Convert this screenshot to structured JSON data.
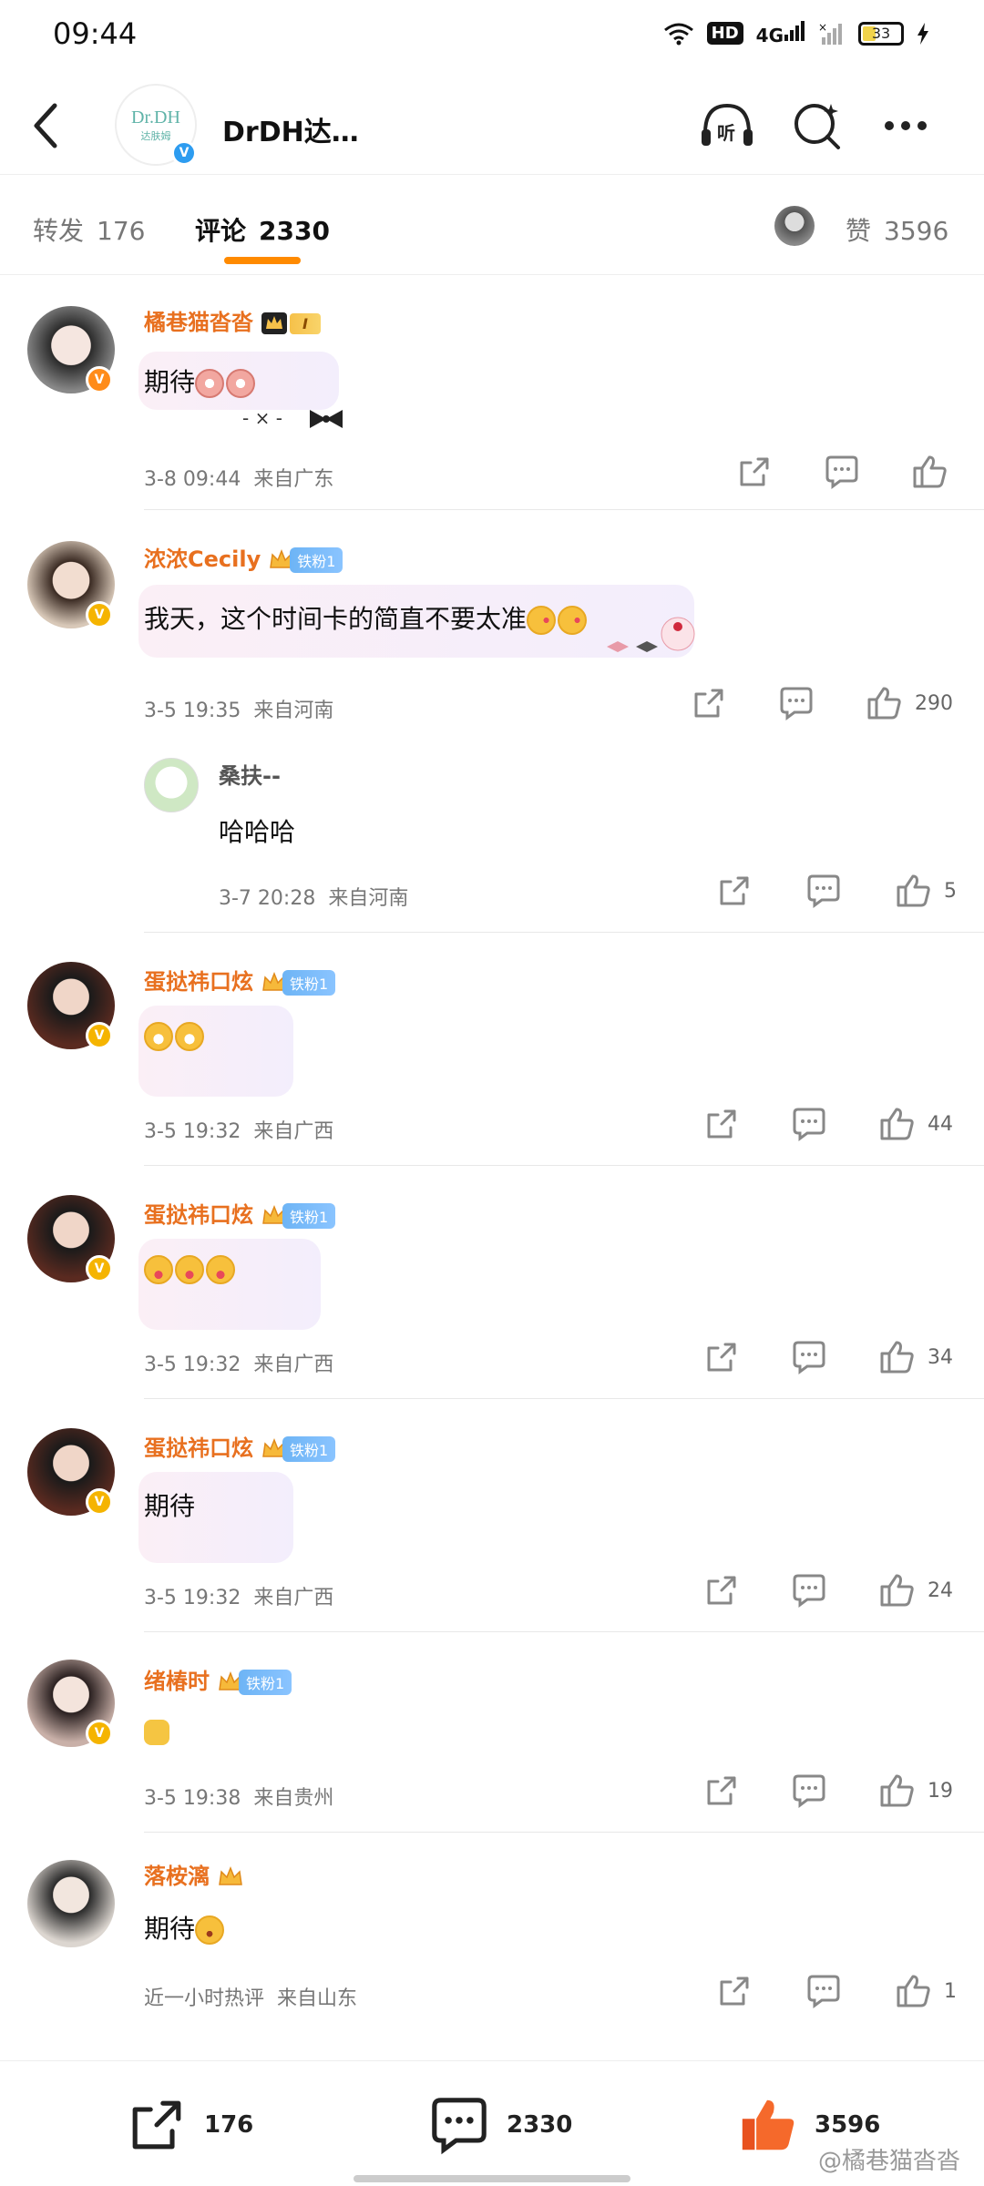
{
  "status_bar": {
    "time": "09:44",
    "network": "4G",
    "hd": "HD",
    "battery": "33"
  },
  "header": {
    "account_name": "DrDH达…",
    "logo_text": "Dr.DH",
    "logo_sub": "达肤姆",
    "listen_label": "听"
  },
  "tabs": {
    "repost_label": "转发",
    "repost_count": "176",
    "comment_label": "评论",
    "comment_count": "2330",
    "like_label": "赞",
    "like_count": "3596"
  },
  "comments": [
    {
      "name": "橘巷猫沓沓",
      "rank_badge": "I",
      "text": "期待",
      "date": "3-8 09:44",
      "location": "来自广东",
      "likes": ""
    },
    {
      "name": "浓浓Cecily",
      "fan_badge": "铁粉1",
      "text": "我天，这个时间卡的简直不要太准",
      "date": "3-5 19:35",
      "location": "来自河南",
      "likes": "290",
      "reply": {
        "name": "桑扶--",
        "text": "哈哈哈",
        "date": "3-7 20:28",
        "location": "来自河南",
        "likes": "5"
      }
    },
    {
      "name": "蛋挞祎口炫",
      "fan_badge": "铁粉1",
      "text": "",
      "date": "3-5 19:32",
      "location": "来自广西",
      "likes": "44"
    },
    {
      "name": "蛋挞祎口炫",
      "fan_badge": "铁粉1",
      "text": "",
      "date": "3-5 19:32",
      "location": "来自广西",
      "likes": "34"
    },
    {
      "name": "蛋挞祎口炫",
      "fan_badge": "铁粉1",
      "text": "期待",
      "date": "3-5 19:32",
      "location": "来自广西",
      "likes": "24"
    },
    {
      "name": "绪椿时",
      "fan_badge": "铁粉1",
      "text": "",
      "date": "3-5 19:38",
      "location": "来自贵州",
      "likes": "19"
    },
    {
      "name": "落桉漓",
      "text": "期待",
      "date": "近一小时热评",
      "location": "来自山东",
      "likes": "1"
    }
  ],
  "bottom_bar": {
    "repost_count": "176",
    "comment_count": "2330",
    "like_count": "3596"
  },
  "watermark": "@橘巷猫沓沓",
  "colors": {
    "accent_orange": "#ff8a00",
    "username_orange": "#e8701f",
    "like_orange": "#f5692b"
  }
}
